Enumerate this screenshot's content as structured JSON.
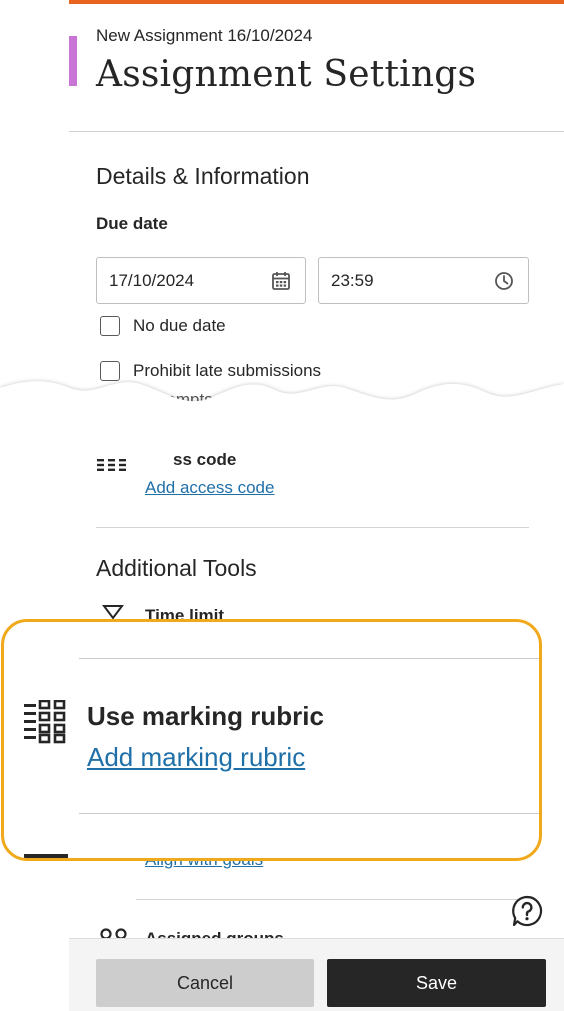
{
  "header": {
    "subtitle": "New Assignment 16/10/2024",
    "title": "Assignment Settings"
  },
  "details": {
    "heading": "Details & Information",
    "due_date_label": "Due date",
    "date_value": "17/10/2024",
    "time_value": "23:59",
    "no_due_date_label": "No due date",
    "prohibit_late_label": "Prohibit late submissions",
    "cut_off_text": "e-pro  empts    mitt"
  },
  "access_code": {
    "title": "Access code",
    "visible_title": "ss code",
    "link": "Add access code"
  },
  "additional_tools": {
    "heading": "Additional Tools",
    "time_limit_label": "Time limit",
    "rubric_title": "Use marking rubric",
    "rubric_link": "Add marking rubric",
    "goals_link": "Align with goals",
    "assigned_groups_label": "Assigned groups"
  },
  "footer": {
    "cancel_label": "Cancel",
    "save_label": "Save"
  },
  "colors": {
    "accent_top": "#e8631f",
    "title_marker": "#c875d5",
    "link": "#1f6fa8",
    "callout_border": "#f0a91a",
    "save_bg": "#262626",
    "cancel_bg": "#cdcdcd"
  },
  "icons": {
    "calendar": "calendar-icon",
    "clock": "clock-icon",
    "access_code": "access-code-icon",
    "time_limit": "hourglass-icon",
    "rubric": "rubric-grid-icon",
    "goals": "goals-icon",
    "groups": "groups-icon",
    "help": "help-bubble-icon"
  }
}
